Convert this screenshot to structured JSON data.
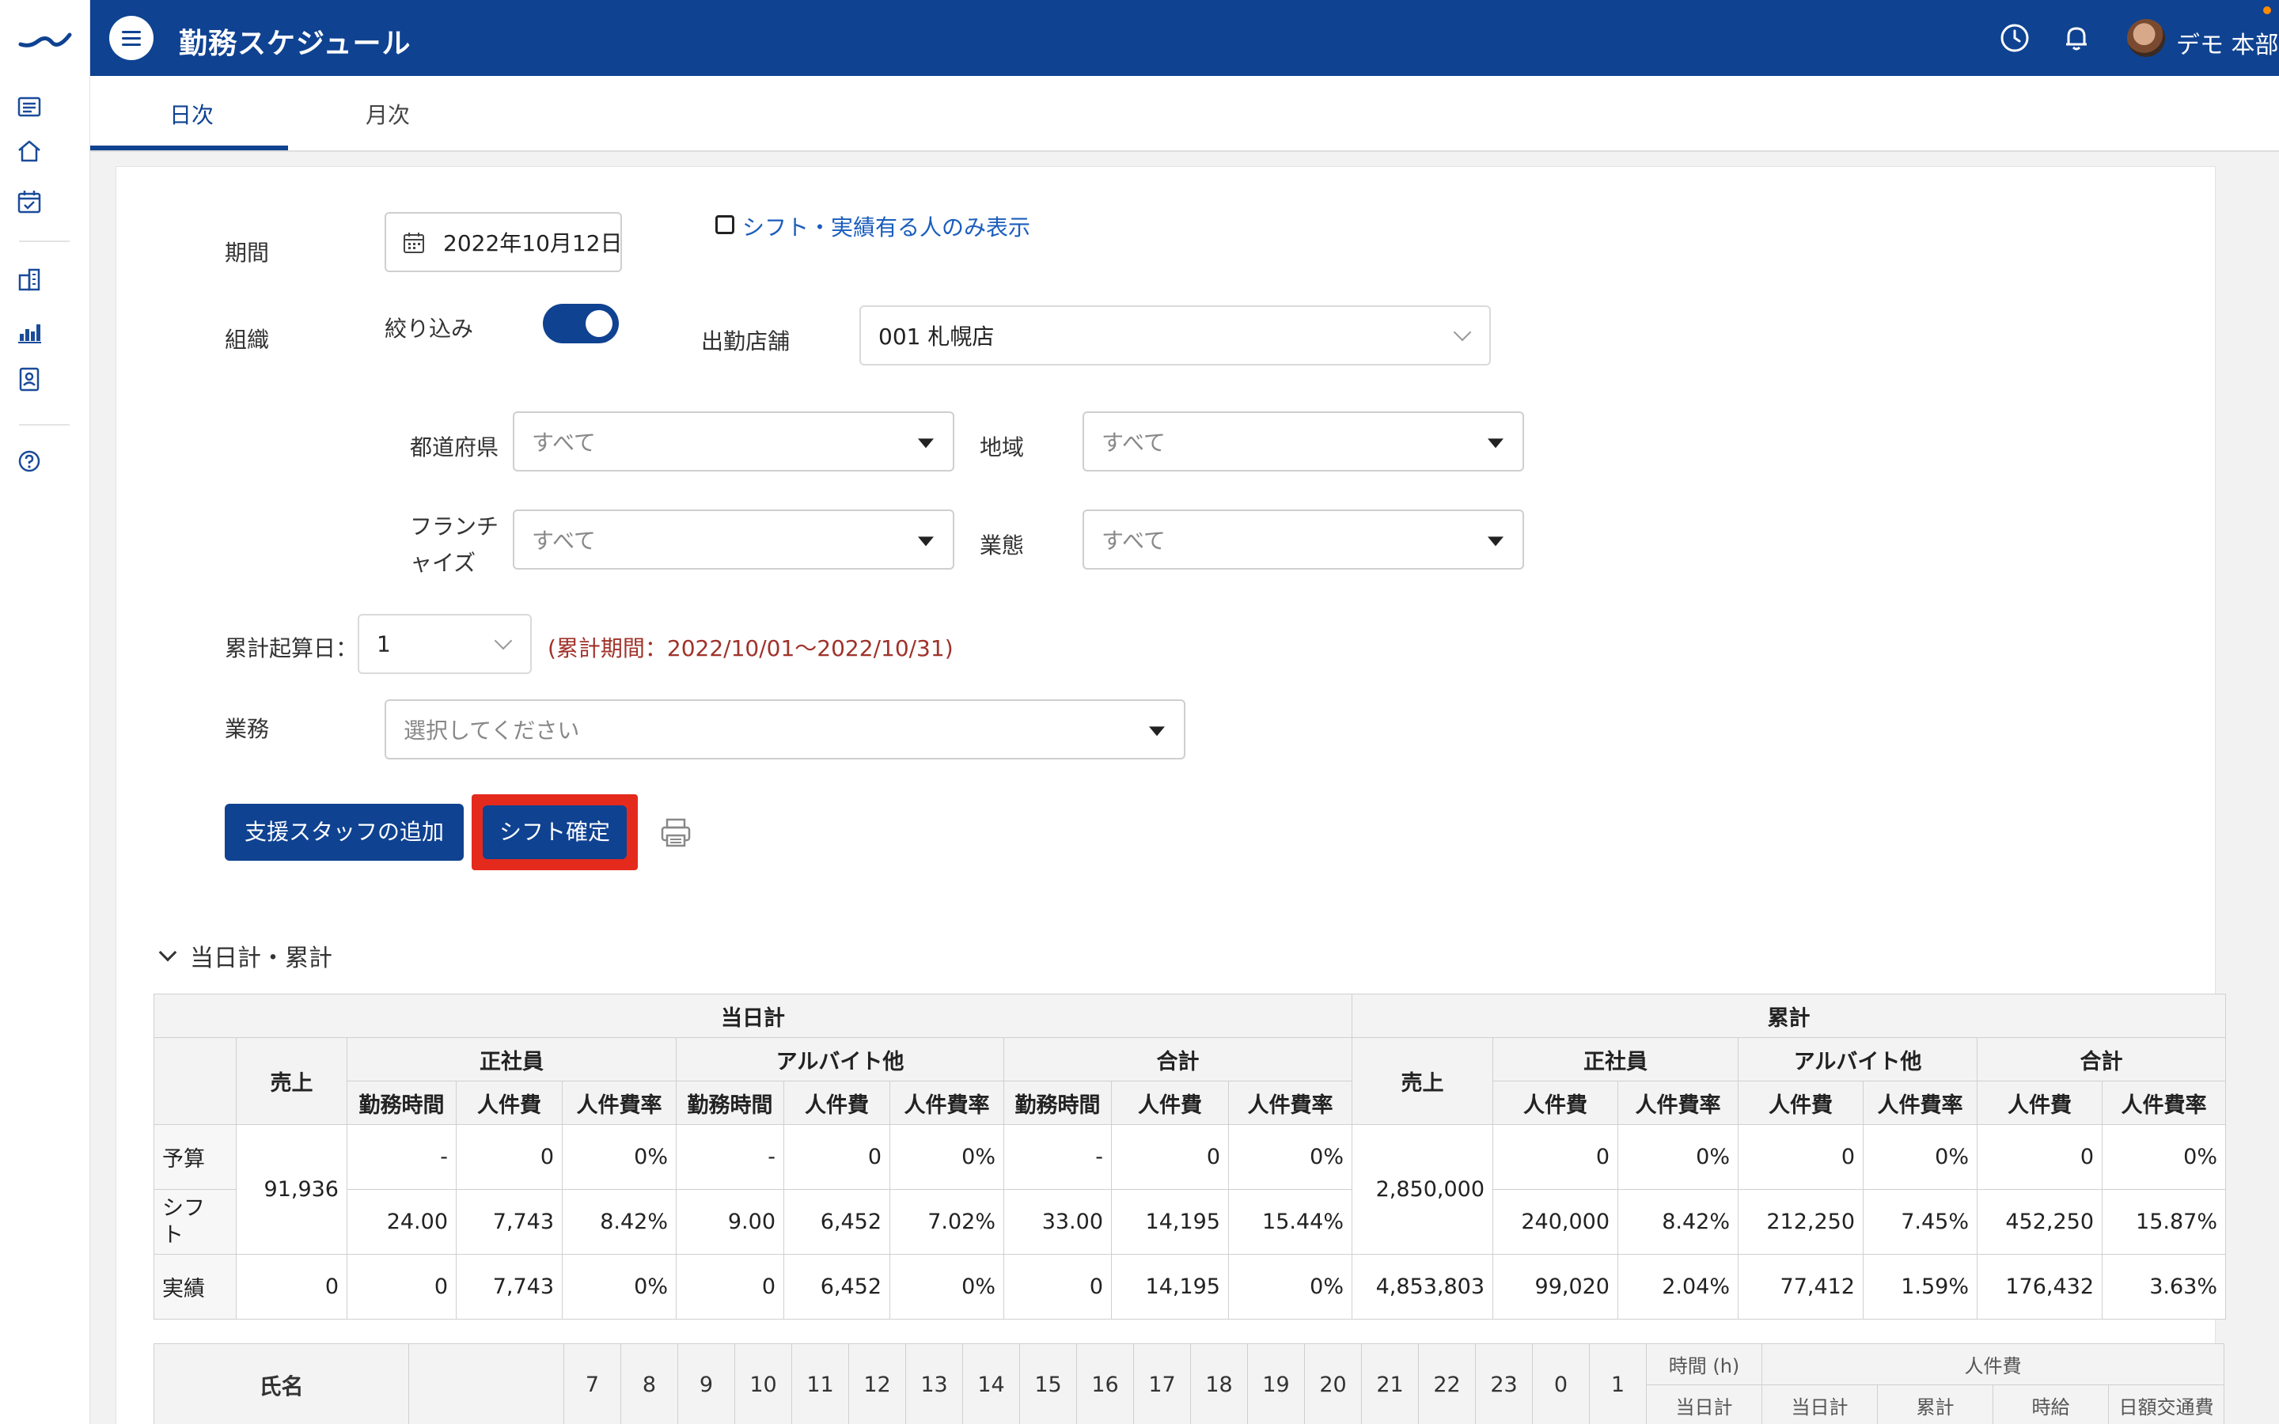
{
  "app": {
    "title": "勤務スケジュール",
    "user_name": "デモ 本部",
    "brand_color": "#0f4291"
  },
  "rail": {
    "icons": [
      "logo-icon",
      "list-icon",
      "home-icon",
      "calendar-check-icon",
      "building-icon",
      "bar-chart-icon",
      "id-badge-icon",
      "help-icon"
    ]
  },
  "tabs": [
    {
      "label": "日次",
      "active": true
    },
    {
      "label": "月次",
      "active": false
    }
  ],
  "filters": {
    "period_label": "期間",
    "date_value": "2022年10月12日",
    "only_with_shift_label": "シフト・実績有る人のみ表示",
    "only_with_shift_checked": false,
    "org_label": "組織",
    "narrow_label": "絞り込み",
    "narrow_on": true,
    "store_label": "出勤店舗",
    "store_value": "001 札幌店",
    "prefecture_label": "都道府県",
    "prefecture_value": "すべて",
    "region_label": "地域",
    "region_value": "すべて",
    "franchise_label_1": "フランチ",
    "franchise_label_2": "ャイズ",
    "franchise_value": "すべて",
    "business_type_label": "業態",
    "business_type_value": "すべて",
    "cumulative_start_label": "累計起算日：",
    "cumulative_start_value": "1",
    "cumulative_range": "(累計期間：2022/10/01〜2022/10/31)",
    "task_label": "業務",
    "task_placeholder": "選択してください"
  },
  "actions": {
    "add_support_staff": "支援スタッフの追加",
    "confirm_shift": "シフト確定"
  },
  "summary": {
    "section_title": "当日計・累計",
    "daily_header": "当日計",
    "cumulative_header": "累計",
    "sales": "売上",
    "regular": "正社員",
    "parttime": "アルバイト他",
    "total": "合計",
    "hours": "勤務時間",
    "cost": "人件費",
    "ratio": "人件費率",
    "rows": {
      "budget": {
        "label": "予算",
        "reg_h": "-",
        "reg_c": "0",
        "reg_r": "0%",
        "pt_h": "-",
        "pt_c": "0",
        "pt_r": "0%",
        "tot_h": "-",
        "tot_c": "0",
        "tot_r": "0%",
        "c_reg_c": "0",
        "c_reg_r": "0%",
        "c_pt_c": "0",
        "c_pt_r": "0%",
        "c_tot_c": "0",
        "c_tot_r": "0%"
      },
      "shift": {
        "label1": "シフ",
        "label2": "ト",
        "reg_h": "24.00",
        "reg_c": "7,743",
        "reg_r": "8.42%",
        "pt_h": "9.00",
        "pt_c": "6,452",
        "pt_r": "7.02%",
        "tot_h": "33.00",
        "tot_c": "14,195",
        "tot_r": "15.44%",
        "c_reg_c": "240,000",
        "c_reg_r": "8.42%",
        "c_pt_c": "212,250",
        "c_pt_r": "7.45%",
        "c_tot_c": "452,250",
        "c_tot_r": "15.87%"
      },
      "actual": {
        "label": "実績",
        "sales": "0",
        "reg_h": "0",
        "reg_c": "7,743",
        "reg_r": "0%",
        "pt_h": "0",
        "pt_c": "6,452",
        "pt_r": "0%",
        "tot_h": "0",
        "tot_c": "14,195",
        "tot_r": "0%",
        "c_sales": "4,853,803",
        "c_reg_c": "99,020",
        "c_reg_r": "2.04%",
        "c_pt_c": "77,412",
        "c_pt_r": "1.59%",
        "c_tot_c": "176,432",
        "c_tot_r": "3.63%"
      }
    },
    "daily_sales_budget_shift": "91,936",
    "cum_sales_budget_shift": "2,850,000"
  },
  "staff_table": {
    "name_header": "氏名",
    "hours": [
      "7",
      "8",
      "9",
      "10",
      "11",
      "12",
      "13",
      "14",
      "15",
      "16",
      "17",
      "18",
      "19",
      "20",
      "21",
      "22",
      "23",
      "0",
      "1"
    ],
    "time_h": "時間 (h)",
    "labor_cost": "人件費",
    "sub_day_total": "当日計",
    "sub_cost_day": "当日計",
    "sub_cost_cum": "累計",
    "sub_hourly": "時給",
    "sub_transport": "日額交通費"
  }
}
